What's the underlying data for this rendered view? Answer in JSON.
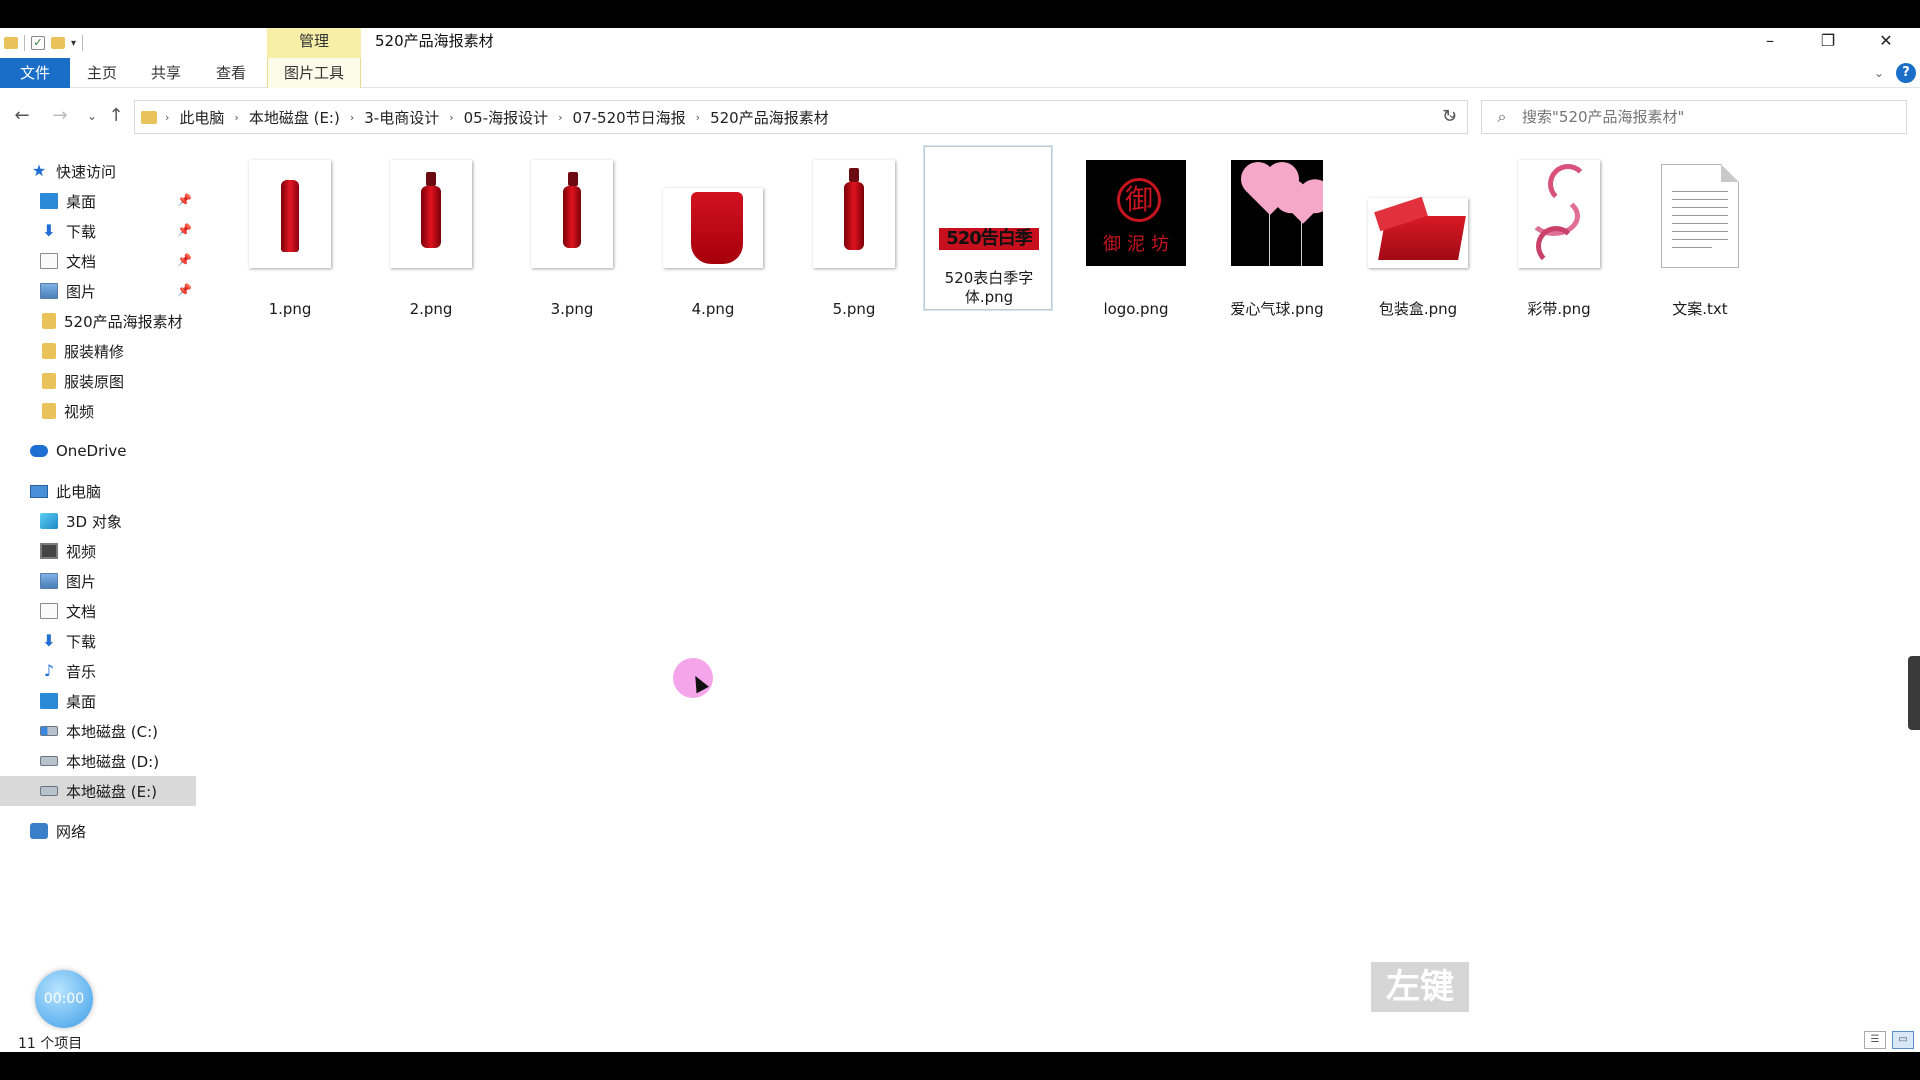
{
  "titlebar": {
    "context_tab_group": "管理",
    "window_title": "520产品海报素材",
    "minimize": "–",
    "restore": "❐",
    "close": "✕"
  },
  "ribbon": {
    "tabs": [
      "文件",
      "主页",
      "共享",
      "查看",
      "图片工具"
    ],
    "help": "?",
    "collapse": "⌄"
  },
  "nav": {
    "back": "←",
    "forward": "→",
    "recent": "⌄",
    "up": "↑",
    "breadcrumbs": [
      "此电脑",
      "本地磁盘 (E:)",
      "3-电商设计",
      "05-海报设计",
      "07-520节日海报",
      "520产品海报素材"
    ],
    "refresh": "↻",
    "search_placeholder": "搜索\"520产品海报素材\""
  },
  "sidebar": {
    "quick_access": "快速访问",
    "quick_items": [
      "桌面",
      "下载",
      "文档",
      "图片"
    ],
    "folders": [
      "520产品海报素材",
      "服装精修",
      "服装原图",
      "视频"
    ],
    "onedrive": "OneDrive",
    "this_pc": "此电脑",
    "pc_items": [
      "3D 对象",
      "视频",
      "图片",
      "文档",
      "下载",
      "音乐",
      "桌面",
      "本地磁盘 (C:)",
      "本地磁盘 (D:)",
      "本地磁盘 (E:)"
    ],
    "network": "网络"
  },
  "files": [
    {
      "name": "1.png",
      "kind": "tube-icon"
    },
    {
      "name": "2.png",
      "kind": "bottle-icon"
    },
    {
      "name": "3.png",
      "kind": "bottle-icon"
    },
    {
      "name": "4.png",
      "kind": "red-pack-icon"
    },
    {
      "name": "5.png",
      "kind": "bottle-icon"
    },
    {
      "name": "520表白季字体.png",
      "kind": "font-banner-icon",
      "banner_text": "520告白季"
    },
    {
      "name": "logo.png",
      "kind": "logo-icon",
      "logo_text": "御泥坊"
    },
    {
      "name": "爱心气球.png",
      "kind": "balloon-icon"
    },
    {
      "name": "包装盒.png",
      "kind": "gift-box-icon"
    },
    {
      "name": "彩带.png",
      "kind": "ribbon-icon"
    },
    {
      "name": "文案.txt",
      "kind": "text-file-icon"
    }
  ],
  "status": {
    "item_count": "11 个项目"
  },
  "overlays": {
    "timer": "00:00",
    "key_hint": "左键"
  },
  "colors": {
    "accent": "#1a6ec7",
    "context_tab": "#f7efa8",
    "product_red": "#d41220",
    "cursor_halo": "#f396e8"
  }
}
